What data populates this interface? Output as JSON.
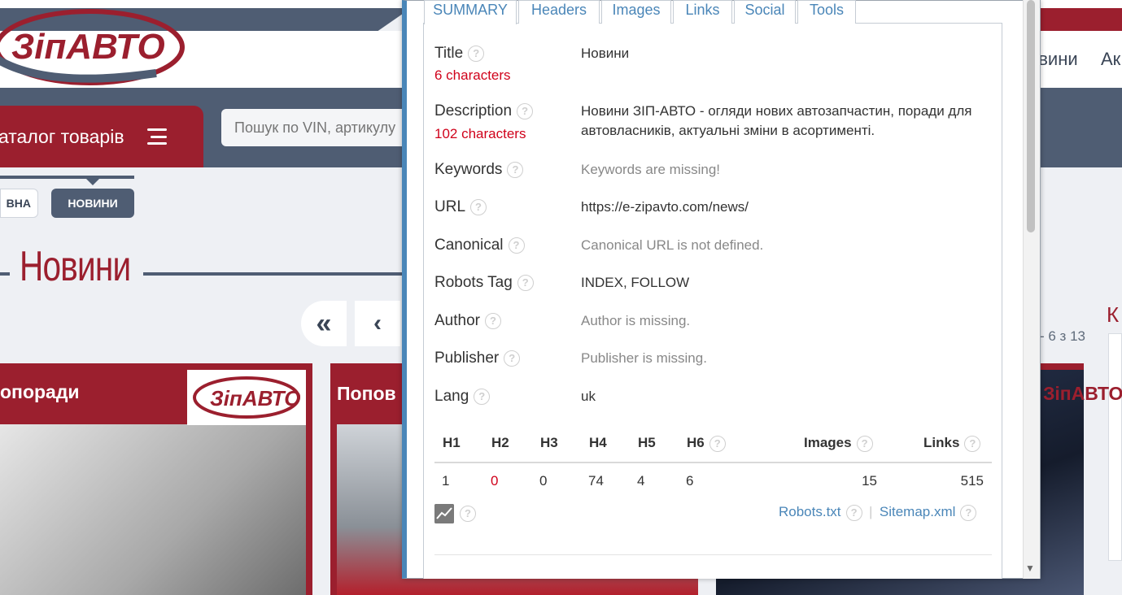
{
  "site": {
    "logo_text": "ЗіпАВТО",
    "catalog_label": "аталог товарів",
    "search_placeholder": "Пошук по VIN, артикулу",
    "menu_news": "овини",
    "menu_actions": "Ак",
    "breadcrumb_home": "ВНА",
    "breadcrumb_current": "НОВИНИ",
    "page_title": "Новини",
    "pagination_first": "«",
    "pagination_prev": "‹",
    "results_count": "- 6 з 13",
    "sidebar_heading": "К",
    "cards": [
      {
        "title": "опоради",
        "logo": "ЗіпАВТО"
      },
      {
        "title": "Попов",
        "logo": ""
      },
      {
        "title": "",
        "logo": "ЗіпАВТО"
      }
    ]
  },
  "popup": {
    "tabs": [
      {
        "label": "SUMMARY",
        "active": true
      },
      {
        "label": "Headers",
        "active": false
      },
      {
        "label": "Images",
        "active": false
      },
      {
        "label": "Links",
        "active": false
      },
      {
        "label": "Social",
        "active": false
      },
      {
        "label": "Tools",
        "active": false
      }
    ],
    "rows": {
      "title_label": "Title",
      "title_count": "6 characters",
      "title_value": "Новини",
      "description_label": "Description",
      "description_count": "102 characters",
      "description_value": "Новини ЗІП-АВТО - огляди нових автозапчастин, поради для автовласників, актуальні зміни в асортименті.",
      "keywords_label": "Keywords",
      "keywords_value": "Keywords are missing!",
      "url_label": "URL",
      "url_value": "https://e-zipavto.com/news/",
      "canonical_label": "Canonical",
      "canonical_value": "Canonical URL is not defined.",
      "robots_label": "Robots Tag",
      "robots_value": "INDEX, FOLLOW",
      "author_label": "Author",
      "author_value": "Author is missing.",
      "publisher_label": "Publisher",
      "publisher_value": "Publisher is missing.",
      "lang_label": "Lang",
      "lang_value": "uk"
    },
    "headings_table": {
      "headers": [
        "H1",
        "H2",
        "H3",
        "H4",
        "H5",
        "H6",
        "Images",
        "Links"
      ],
      "values": [
        "1",
        "0",
        "0",
        "74",
        "4",
        "6",
        "15",
        "515"
      ]
    },
    "help_glyph": "?",
    "robots_link": "Robots.txt",
    "sitemap_link": "Sitemap.xml",
    "separator": "|"
  },
  "colors": {
    "brand_red": "#9b1f2e",
    "nav_slate": "#4f5d73",
    "link_blue": "#4a86b8",
    "warning_red": "#d0021b"
  }
}
